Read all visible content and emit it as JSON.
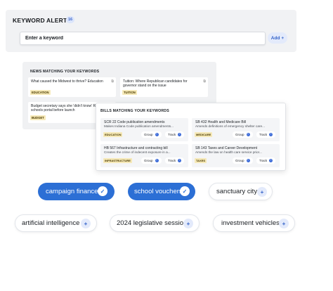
{
  "keyword_alerts": {
    "title": "KEYWORD ALERTS",
    "count": "16",
    "input_placeholder": "Enter a keyword",
    "add_label": "Add",
    "add_icon": "+"
  },
  "news": {
    "title": "NEWS MATCHING YOUR KEYWORDS",
    "items": [
      {
        "headline": "What caused the Midwest to thrive? Education",
        "tag": "EDUCATION"
      },
      {
        "headline": "Tuition: Where Republican candidates for governor stand on the issue",
        "tag": "TUITION"
      },
      {
        "headline": "Budget secretary says she 'didn't know' Rokita's schools portal before launch",
        "tag": "BUDGET"
      }
    ]
  },
  "bills": {
    "title": "BILLS MATCHING YOUR KEYWORDS",
    "group_label": "Group",
    "track_label": "Track",
    "items": [
      {
        "title": "SCR 22  Code publication amendments",
        "desc": "Makes Indiana Code publication amendments...",
        "tag": "EDUCATION"
      },
      {
        "title": "SB 432  Health and Medicare Bill",
        "desc": "Amends definitions of emergency shelter care...",
        "tag": "MEDICARE"
      },
      {
        "title": "HB 567  Infrastructure and contracting bill",
        "desc": "Creates the crime of indecent exposure in a...",
        "tag": "INFRASTRUCTURE"
      },
      {
        "title": "SB 143  Taxes and Career Development",
        "desc": "Amends the law on health care service prior...",
        "tag": "TAXES"
      }
    ]
  },
  "chips": [
    {
      "label": "campaign finance",
      "selected": true
    },
    {
      "label": "school vouchers",
      "selected": true
    },
    {
      "label": "sanctuary city",
      "selected": false
    },
    {
      "label": "artificial intelligence",
      "selected": false
    },
    {
      "label": "2024 legislative session",
      "selected": false
    },
    {
      "label": "investment vehicles",
      "selected": false
    }
  ],
  "icons": {
    "check": "check-icon",
    "plus": "plus-icon"
  },
  "colors": {
    "accent": "#2c6fd5",
    "tag_bg": "#f6e9b8",
    "panel_bg": "#f0f1f3"
  }
}
